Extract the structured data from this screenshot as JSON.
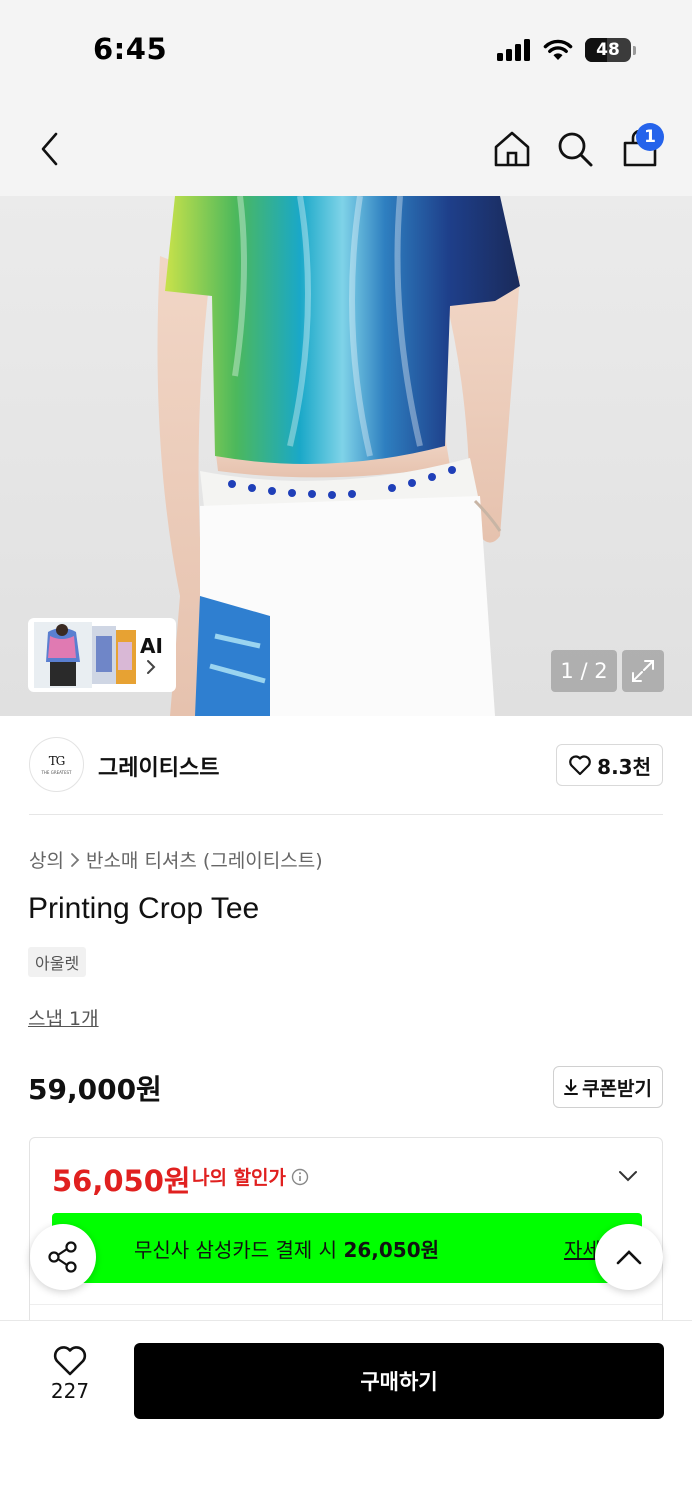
{
  "status_bar": {
    "time": "6:45",
    "battery": "48"
  },
  "nav": {
    "cart_count": "1"
  },
  "gallery": {
    "ai_label": "AI",
    "page_indicator": "1 / 2"
  },
  "brand": {
    "name": "그레이티스트",
    "likes": "8.3천",
    "logo_text": "TG"
  },
  "product": {
    "breadcrumb": [
      "상의",
      "반소매 티셔츠 (그레이티스트)"
    ],
    "title": "Printing Crop Tee",
    "tag": "아울렛",
    "snap_link": "스냅 1개",
    "price": "59,000원",
    "coupon_label": "쿠폰받기"
  },
  "discount": {
    "sale_price": "56,050원",
    "sale_label": "나의 할인가",
    "promo_prefix": "무신사 삼성카드 결제 시 ",
    "promo_amount": "26,050원",
    "promo_link": "자세히"
  },
  "bottom_bar": {
    "wish_count": "227",
    "buy_label": "구매하기"
  },
  "colors": {
    "sale_red": "#e0201f",
    "promo_green": "#00ff00",
    "badge_blue": "#2563eb"
  }
}
